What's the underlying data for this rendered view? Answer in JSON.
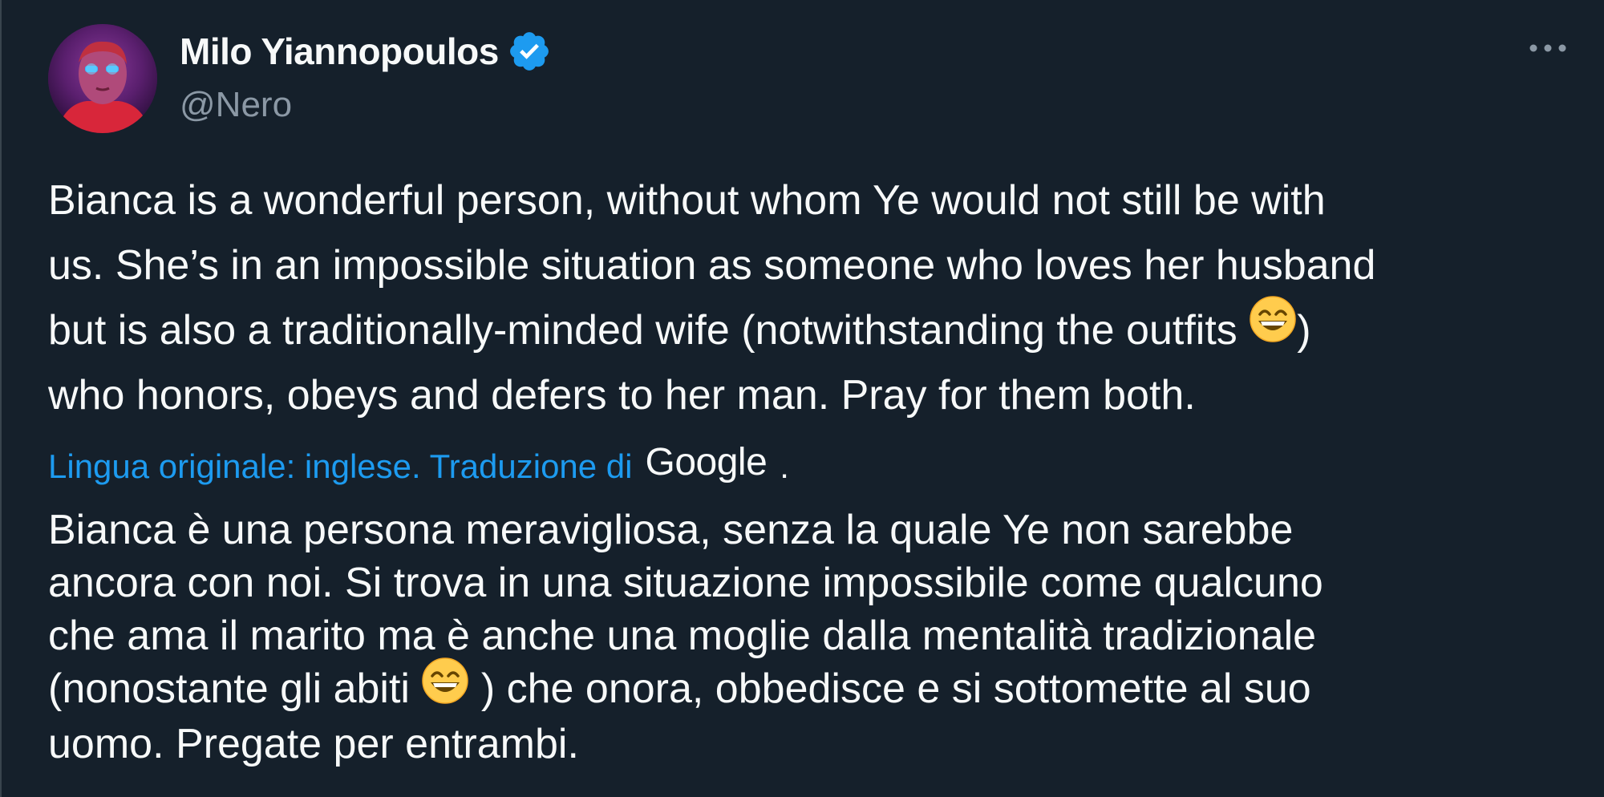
{
  "author": {
    "display_name": "Milo Yiannopoulos",
    "handle": "@Nero",
    "verified": true,
    "verified_color": "#1d9bf0",
    "avatar_icon": "avatar-icon"
  },
  "menu": {
    "more_icon": "more-horizontal-icon"
  },
  "tweet": {
    "original_text_part1": "Bianca is a wonderful person, without whom Ye would not still be with\nus. She’s in an impossible situation as someone who loves her husband\nbut is also a traditionally-minded wife (notwithstanding the outfits ",
    "original_text_part2": ")\nwho honors, obeys and defers to her man. Pray for them both.",
    "translation_label": "Lingua originale: inglese. Traduzione di",
    "translation_provider": "Google",
    "translation_period": ".",
    "translated_text_part1": "Bianca è una persona meravigliosa, senza la quale Ye non sarebbe\nancora con noi. Si trova in una situazione impossibile come qualcuno\nche ama il marito ma è anche una moglie dalla mentalità tradizionale\n(nonostante gli abiti ",
    "translated_text_part2": " ) che onora, obbedisce e si sottomette al suo\nuomo. Pregate per entrambi.",
    "emoji_name": "grinning-face-with-smiling-eyes-icon"
  },
  "colors": {
    "background": "#15202b",
    "text": "#f7f9f9",
    "secondary_text": "#8b98a5",
    "link": "#1d9bf0"
  }
}
